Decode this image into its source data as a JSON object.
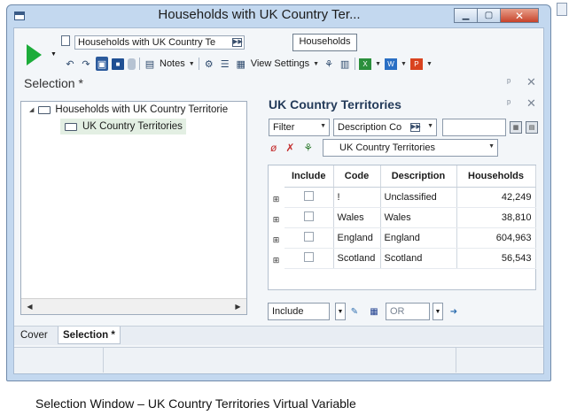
{
  "window": {
    "title": "Households with UK Country Ter...",
    "minimize": "▁",
    "maximize": "▢",
    "close": "✕"
  },
  "toolbar": {
    "selection_name": "Households with UK Country Te",
    "entity": "Households",
    "notes_label": "Notes",
    "view_settings_label": "View Settings"
  },
  "selection_pane": {
    "heading": "Selection *",
    "pin": "ᵖ",
    "close": "✕"
  },
  "tree": {
    "root_label": "Households with UK Country Territorie",
    "child_label": "UK Country Territories"
  },
  "variable_pane": {
    "title": "UK Country Territories",
    "filter_label": "Filter",
    "field_label": "Description Co",
    "dropdown_value": "UK Country Territories",
    "pin": "ᵖ",
    "close": "✕"
  },
  "table": {
    "columns": [
      "Include",
      "Code",
      "Description",
      "Households"
    ],
    "rows": [
      {
        "code": "!",
        "description": "Unclassified",
        "households": "42,249"
      },
      {
        "code": "Wales",
        "description": "Wales",
        "households": "38,810"
      },
      {
        "code": "England",
        "description": "England",
        "households": "604,963"
      },
      {
        "code": "Scotland",
        "description": "Scotland",
        "households": "56,543"
      }
    ]
  },
  "bottom_bar": {
    "include_label": "Include",
    "operator_label": "OR"
  },
  "tabs": [
    {
      "label": "Cover",
      "active": false
    },
    {
      "label": "Selection *",
      "active": true
    }
  ],
  "caption": "Selection Window – UK Country Territories Virtual Variable",
  "colors": {
    "title_bar": "#c3d8ef",
    "play": "#1cac3a",
    "close_button": "#c7432b"
  }
}
